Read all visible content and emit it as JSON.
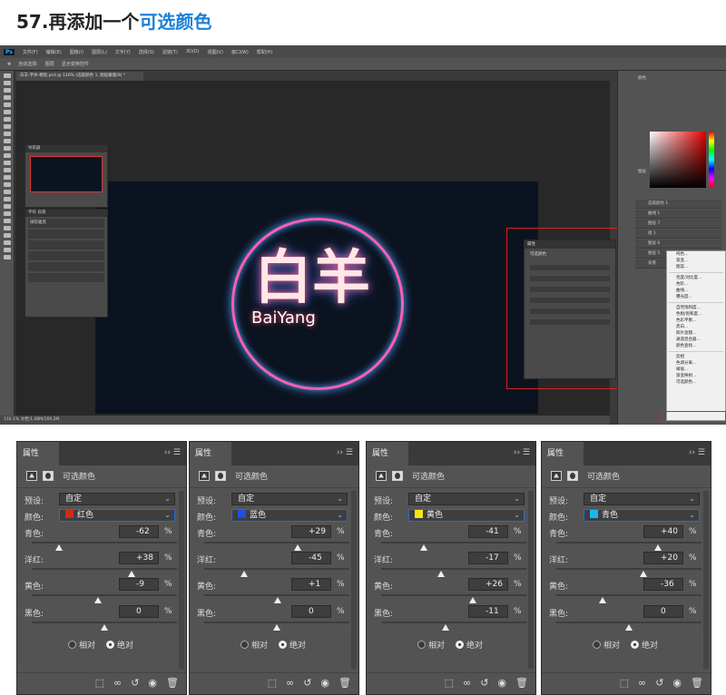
{
  "title": {
    "step": "57.",
    "main": "再添加一个",
    "highlight": "可选颜色"
  },
  "ps": {
    "menu": [
      "文件(F)",
      "编辑(E)",
      "图像(I)",
      "图层(L)",
      "文字(Y)",
      "选择(S)",
      "滤镜(T)",
      "3D(D)",
      "视图(V)",
      "窗口(W)",
      "帮助(H)"
    ],
    "logo": "Ps",
    "options": [
      "自动选择:",
      "图层",
      "显示变换控件"
    ],
    "doc_tab": "白羊-字体-教程.psd @ 116% (选取颜色 1, 图层蒙版/8) *",
    "status": "116.1%   文档:1.48M/169.2M",
    "nav_label": "导航器",
    "char_tabs": [
      "字符",
      "段落"
    ],
    "font_name": "微软雅黑",
    "art_main": "白羊",
    "art_sub": "BaiYang",
    "popup_header": "属性",
    "popup_title": "可选颜色",
    "color_header": "颜色",
    "layers_tabs": [
      "图层",
      "通道",
      "路径"
    ],
    "layers": [
      "选取颜色 1",
      "曲线 1",
      "图层 7",
      "组 1",
      "图层 6",
      "图层 5",
      "背景"
    ],
    "ctx_menu": [
      "纯色...",
      "渐变...",
      "图案...",
      "亮度/对比度...",
      "色阶...",
      "曲线...",
      "曝光度...",
      "自然饱和度...",
      "色相/饱和度...",
      "色彩平衡...",
      "黑白...",
      "照片滤镜...",
      "通道混合器...",
      "颜色查找...",
      "反相",
      "色调分离...",
      "阈值...",
      "渐变映射...",
      "可选颜色..."
    ]
  },
  "panels": [
    {
      "tab": "属性",
      "title": "可选颜色",
      "preset_label": "预设:",
      "preset": "自定",
      "color_label": "颜色:",
      "color_name": "红色",
      "color_swatch": "#d12a1b",
      "sliders": [
        {
          "label": "青色:",
          "value": "-62",
          "v": -62
        },
        {
          "label": "洋红:",
          "value": "+38",
          "v": 38
        },
        {
          "label": "黄色:",
          "value": "-9",
          "v": -9
        },
        {
          "label": "黑色:",
          "value": "0",
          "v": 0
        }
      ],
      "relative": "相对",
      "absolute": "绝对",
      "pct": "%"
    },
    {
      "tab": "属性",
      "title": "可选颜色",
      "preset_label": "预设:",
      "preset": "自定",
      "color_label": "颜色:",
      "color_name": "蓝色",
      "color_swatch": "#1f4fe0",
      "sliders": [
        {
          "label": "青色:",
          "value": "+29",
          "v": 29
        },
        {
          "label": "洋红:",
          "value": "-45",
          "v": -45
        },
        {
          "label": "黄色:",
          "value": "+1",
          "v": 1
        },
        {
          "label": "黑色:",
          "value": "0",
          "v": 0
        }
      ],
      "relative": "相对",
      "absolute": "绝对",
      "pct": "%"
    },
    {
      "tab": "属性",
      "title": "可选颜色",
      "preset_label": "预设:",
      "preset": "自定",
      "color_label": "颜色:",
      "color_name": "黄色",
      "color_swatch": "#f5e31a",
      "sliders": [
        {
          "label": "青色:",
          "value": "-41",
          "v": -41
        },
        {
          "label": "洋红:",
          "value": "-17",
          "v": -17
        },
        {
          "label": "黄色:",
          "value": "+26",
          "v": 26
        },
        {
          "label": "黑色:",
          "value": "-11",
          "v": -11
        }
      ],
      "relative": "相对",
      "absolute": "绝对",
      "pct": "%"
    },
    {
      "tab": "属性",
      "title": "可选颜色",
      "preset_label": "预设:",
      "preset": "自定",
      "color_label": "颜色:",
      "color_name": "青色",
      "color_swatch": "#19b7f0",
      "sliders": [
        {
          "label": "青色:",
          "value": "+40",
          "v": 40
        },
        {
          "label": "洋红:",
          "value": "+20",
          "v": 20
        },
        {
          "label": "黄色:",
          "value": "-36",
          "v": -36
        },
        {
          "label": "黑色:",
          "value": "0",
          "v": 0
        }
      ],
      "relative": "相对",
      "absolute": "绝对",
      "pct": "%"
    }
  ]
}
